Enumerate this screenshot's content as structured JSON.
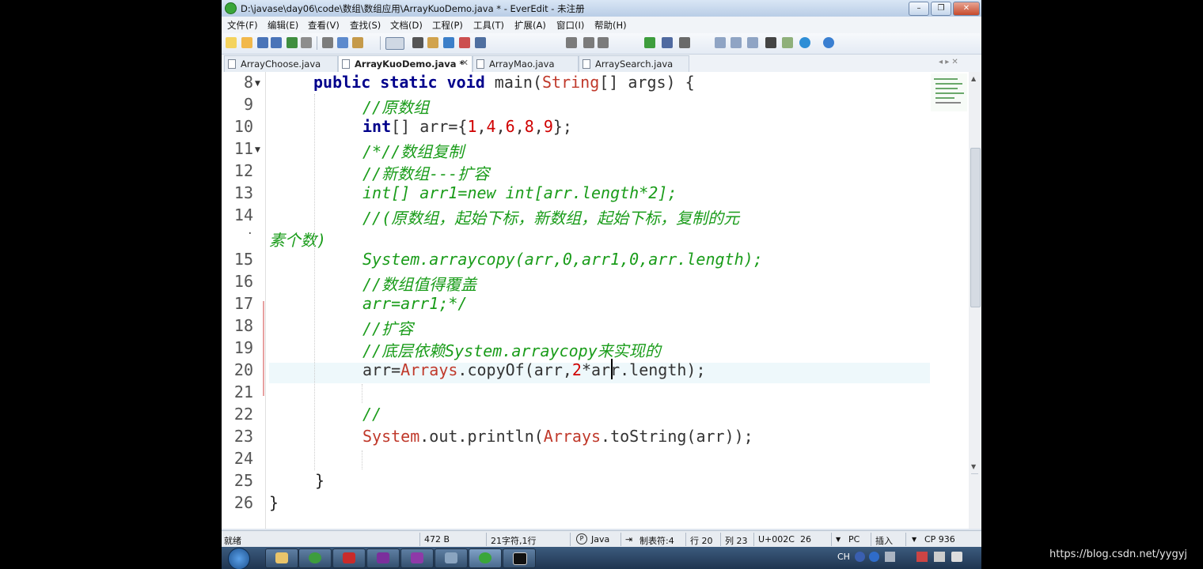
{
  "window": {
    "title": "D:\\javase\\day06\\code\\数组\\数组应用\\ArrayKuoDemo.java * - EverEdit - 未注册",
    "minimize": "–",
    "restore": "❐",
    "close": "✕"
  },
  "menu": [
    "文件(F)",
    "编辑(E)",
    "查看(V)",
    "查找(S)",
    "文档(D)",
    "工程(P)",
    "工具(T)",
    "扩展(A)",
    "窗口(I)",
    "帮助(H)"
  ],
  "tabs": [
    {
      "label": "ArrayChoose.java",
      "close": "",
      "active": false
    },
    {
      "label": "ArrayKuoDemo.java *",
      "close": "✕",
      "active": true
    },
    {
      "label": "ArrayMao.java",
      "close": "",
      "active": false
    },
    {
      "label": "ArraySearch.java",
      "close": "",
      "active": false
    }
  ],
  "tab_scroll": "◂ ▸ ✕",
  "line_numbers": [
    "8",
    "9",
    "10",
    "11",
    "12",
    "13",
    "14",
    "·",
    "15",
    "16",
    "17",
    "18",
    "19",
    "20",
    "21",
    "22",
    "23",
    "24",
    "25",
    "26"
  ],
  "code": {
    "l8": {
      "kw": "public static void",
      "rest1": " main(",
      "cls": "String",
      "rest2": "[] args) {"
    },
    "l9": "//原数组",
    "l10": {
      "kw": "int",
      "a": "[] arr={",
      "n1": "1",
      "c1": ",",
      "n2": "4",
      "c2": ",",
      "n3": "6",
      "c3": ",",
      "n4": "8",
      "c4": ",",
      "n5": "9",
      "b": "};"
    },
    "l11": "/*//数组复制",
    "l12": "//新数组---扩容",
    "l13": "int[] arr1=new int[arr.length*2];",
    "l14": "//(原数组，起始下标，新数组，起始下标，复制的元",
    "l14b": "素个数)",
    "l15": "System.arraycopy(arr,0,arr1,0,arr.length);",
    "l16": "//数组值得覆盖",
    "l17": "arr=arr1;*/",
    "l18": "//扩容",
    "l19": "//底层依赖System.arraycopy来实现的",
    "l20": {
      "a": "arr=",
      "cls": "Arrays",
      "b": ".copyOf(arr,",
      "n": "2",
      "c": "*arr.length);"
    },
    "l22": "//",
    "l23": {
      "cls1": "System",
      "a": ".out.println(",
      "cls2": "Arrays",
      "b": ".toString(arr));"
    },
    "l25": "}",
    "l26": "}"
  },
  "status": {
    "ready": "就绪",
    "size": "472 B",
    "chars": "21字符,1行",
    "lang": "Java",
    "tab": "制表符:4",
    "row": "行 20",
    "col": "列 23",
    "unicode": "U+002C",
    "num": "26",
    "eol": "PC",
    "mode": "插入",
    "cp": "CP 936"
  },
  "tray": {
    "lang": "CH",
    "time": ""
  },
  "watermark": "https://blog.csdn.net/yygyj",
  "colors": {
    "keyword": "#00008b",
    "class": "#c0392b",
    "number": "#d00000",
    "comment": "#1a9c1a",
    "current_line": "#eef8fb"
  }
}
